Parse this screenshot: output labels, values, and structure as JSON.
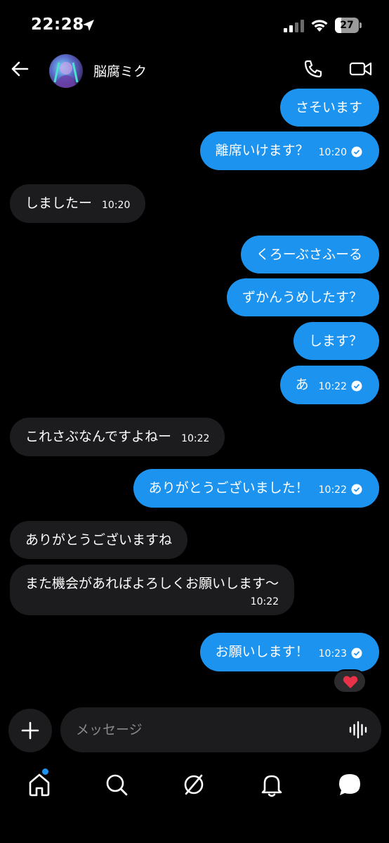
{
  "status_bar": {
    "time": "22:28",
    "battery": "27"
  },
  "header": {
    "contact_name": "脳腐ミク"
  },
  "messages": [
    {
      "text": "さそいます"
    },
    {
      "text": "離席いけます？",
      "time": "10:20"
    },
    {
      "text": "しましたー",
      "time": "10:20"
    },
    {
      "text": "くろーぶさふーる"
    },
    {
      "text": "ずかんうめしたす？"
    },
    {
      "text": "します？"
    },
    {
      "text": "あ",
      "time": "10:22"
    },
    {
      "text": "これさぶなんですよねー",
      "time": "10:22"
    },
    {
      "text": "ありがとうございました！",
      "time": "10:22"
    },
    {
      "text": "ありがとうございますね"
    },
    {
      "text": "また機会があればよろしくお願いします〜",
      "time": "10:22"
    },
    {
      "text": "お願いします！",
      "time": "10:23"
    }
  ],
  "reaction": {
    "icon": "heart-icon",
    "color": "#e8324a"
  },
  "composer": {
    "placeholder": "メッセージ"
  },
  "colors": {
    "outgoing": "#1d93f0",
    "incoming": "#1c1c1e",
    "background": "#000000"
  },
  "nav": {
    "items": [
      "home-icon",
      "search-icon",
      "explore-icon",
      "notifications-icon",
      "chat-icon"
    ]
  }
}
